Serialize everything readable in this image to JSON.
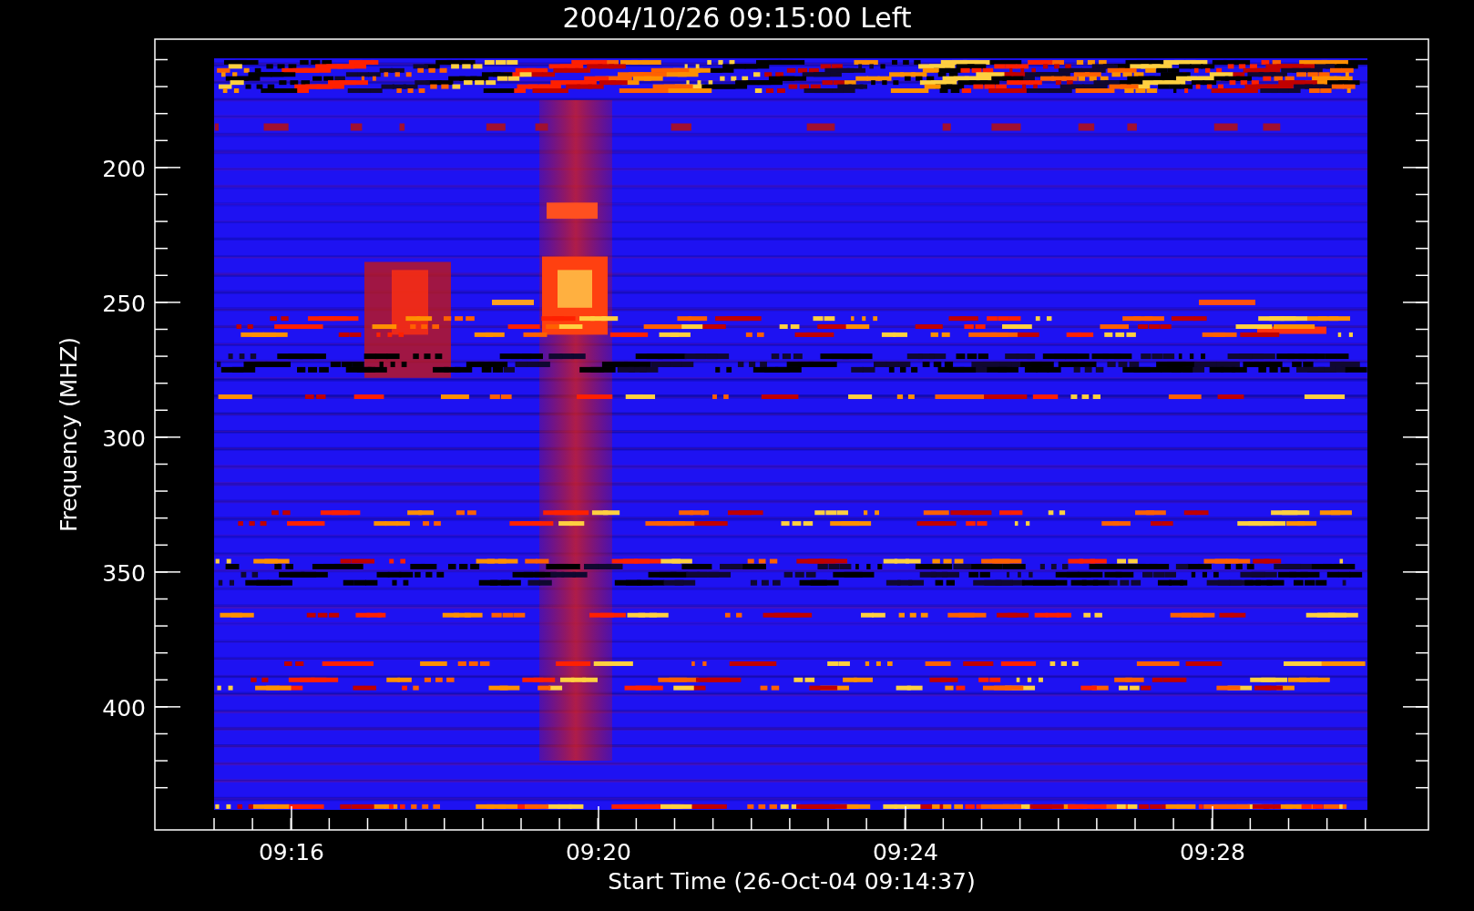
{
  "title": "2004/10/26 09:15:00 Left",
  "x_axis": {
    "label": "Start Time (26-Oct-04 09:14:37)",
    "ticks": [
      "09:16",
      "09:20",
      "09:24",
      "09:28"
    ]
  },
  "y_axis": {
    "label": "Frequency (MHZ)",
    "ticks": [
      "200",
      "250",
      "300",
      "350",
      "400"
    ]
  }
}
